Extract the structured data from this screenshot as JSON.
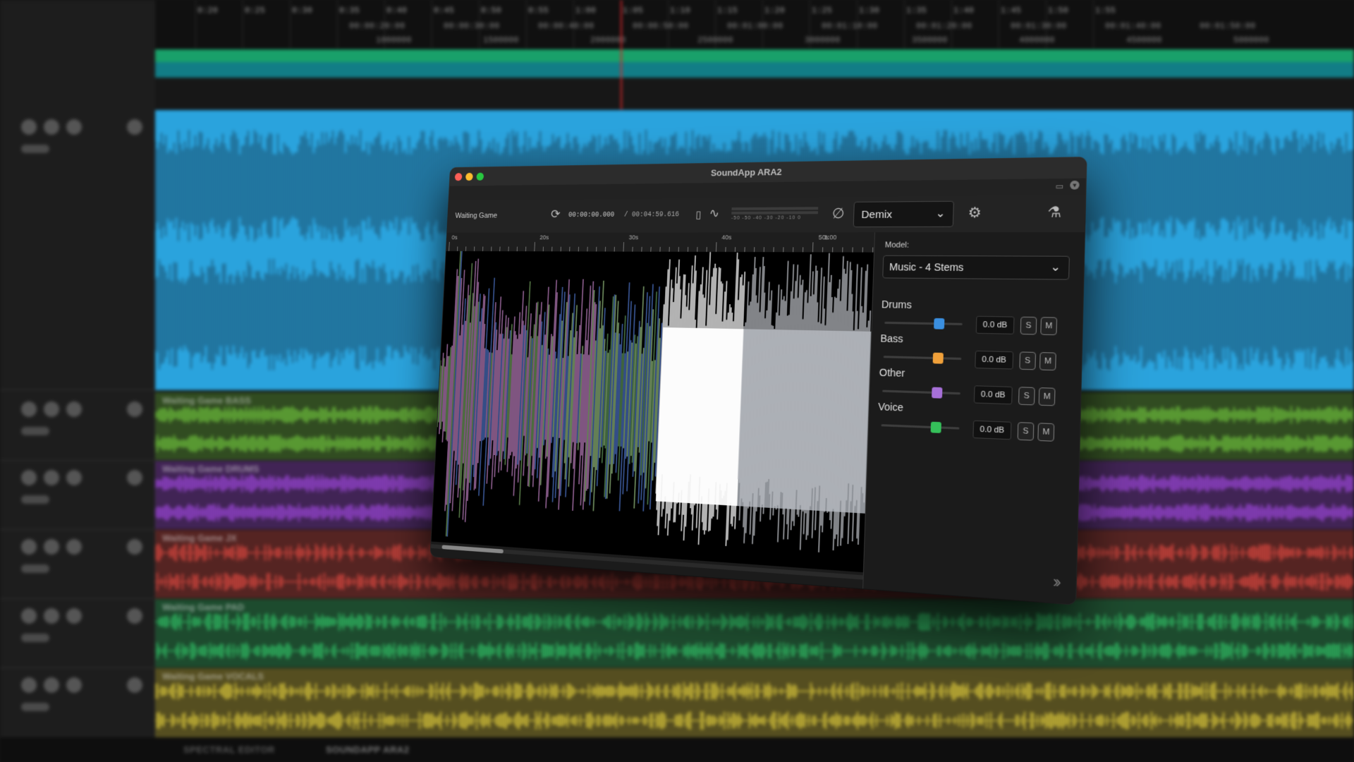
{
  "daw": {
    "ruler_times": [
      "0:20",
      "0:25",
      "0:30",
      "0:35",
      "0:40",
      "0:45",
      "0:50",
      "0:55",
      "1:00",
      "1:05",
      "1:10",
      "1:15",
      "1:20",
      "1:25",
      "1:30",
      "1:35",
      "1:40",
      "1:45",
      "1:50",
      "1:55"
    ],
    "ruler_timecodes": [
      "00:00:20:00",
      "00:00:30:00",
      "00:00:40:00",
      "00:00:50:00",
      "00:01:00:00",
      "00:01:10:00",
      "00:01:20:00",
      "00:01:30:00",
      "00:01:40:00",
      "00:01:50:00"
    ],
    "ruler_samples": [
      "1000000",
      "1500000",
      "2000000",
      "2500000",
      "3000000",
      "3500000",
      "4000000",
      "4500000",
      "5000000"
    ],
    "tracks": [
      {
        "label": "",
        "color": "#2aa3dd"
      },
      {
        "label": "Waiting Game BASS",
        "color": "#6cbe3b"
      },
      {
        "label": "Waiting Game DRUMS",
        "color": "#9b45d8"
      },
      {
        "label": "Waiting Game JX",
        "color": "#d8463e"
      },
      {
        "label": "Waiting Game PAD",
        "color": "#2fbb63"
      },
      {
        "label": "Waiting Game VOCALS",
        "color": "#d7c43a"
      }
    ],
    "bottom_tabs": [
      "SPECTRAL EDITOR",
      "SOUNDAPP ARA2"
    ]
  },
  "plugin": {
    "window_title": "SoundApp ARA2",
    "song_name": "Waiting Game",
    "current_time": "00:00:00.000",
    "total_time": "/ 00:04:59.616",
    "meter_labels": "-50 -50 -40 -30 -20 -10 0",
    "mode": "Demix",
    "ruler_labels": [
      "0s",
      "20s",
      "30s",
      "40s",
      "50s",
      "1:00"
    ],
    "model_label": "Model:",
    "model_value": "Music - 4 Stems",
    "stems": [
      {
        "name": "Drums",
        "gain": "0.0 dB",
        "level": 0.7,
        "color": "#3a8fe0",
        "solo": "S",
        "mute": "M"
      },
      {
        "name": "Bass",
        "gain": "0.0 dB",
        "level": 0.7,
        "color": "#f0a03a",
        "solo": "S",
        "mute": "M"
      },
      {
        "name": "Other",
        "gain": "0.0 dB",
        "level": 0.7,
        "color": "#a770d8",
        "solo": "S",
        "mute": "M"
      },
      {
        "name": "Voice",
        "gain": "0.0 dB",
        "level": 0.7,
        "color": "#35c05a",
        "solo": "S",
        "mute": "M"
      }
    ],
    "icons": {
      "loop": "loop-icon",
      "metronome": "metronome-icon",
      "waveform": "waveform-icon",
      "phase": "phase-invert-icon",
      "settings": "gear-icon",
      "magic": "flask-icon",
      "expand": "chevron-double-right-icon"
    },
    "scroll_position": 0.18
  }
}
